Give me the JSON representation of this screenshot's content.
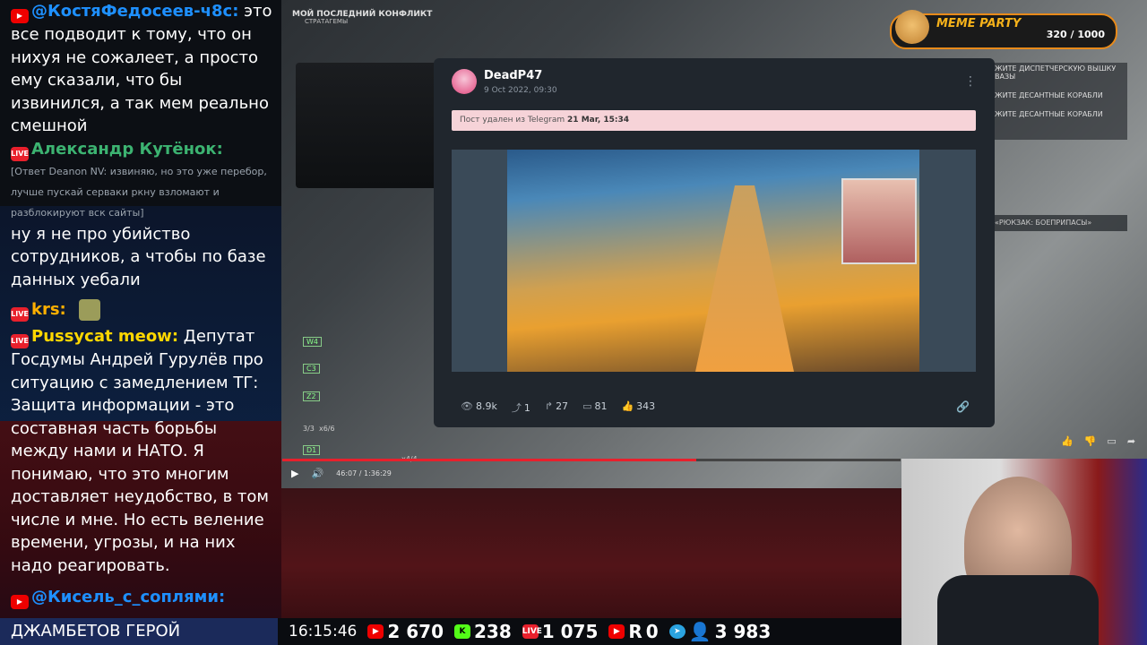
{
  "chat": {
    "messages": [
      {
        "author": "@КостяФедосеев-ч8с:",
        "text": "это все подводит к тому, что он нихуя не сожалеет, а просто ему сказали, что бы извинился, а так мем реально смешной",
        "author_color": "#1e90ff"
      },
      {
        "author": "Александр Кутёнок:",
        "reply": "[Ответ Deanon NV: извиняю, но это уже перебор, лучше пускай серваки ркну взломают и разблокируют вск сайты]",
        "text": "ну я не про убийство сотрудников, а чтобы по базе данных уебали",
        "author_color": "#3cb371"
      },
      {
        "author": "krs:",
        "text": "",
        "author_color": "#ffb000"
      },
      {
        "author": "Pussycat meow:",
        "text": "Депутат Госдумы Андрей Гурулёв про ситуацию с замедлением ТГ: Защита информации - это составная часть борьбы между нами и НАТО. Я понимаю, что это многим доставляет неудобство, в том числе и мне. Но есть веление времени, угрозы, и на них надо реагировать.",
        "author_color": "#ffd700"
      },
      {
        "author": "@Кисель_с_соплями:",
        "text": "",
        "author_color": "#1e90ff"
      }
    ]
  },
  "hud": {
    "title": "МОЙ ПОСЛЕДНИЙ КОНФЛИКТ",
    "subtitle": "СТРАТАГЕМЫ",
    "loadout": [
      {
        "code": "W4"
      },
      {
        "code": "C3"
      },
      {
        "code": "Z2"
      },
      {
        "code": "D1"
      }
    ],
    "ammo": [
      "3/3",
      "x6/6",
      "x4/4"
    ]
  },
  "card": {
    "name": "DeadP47",
    "date": "9 Oct 2022, 09:30",
    "deleted_prefix": "Пост удален из Telegram",
    "deleted_date": "21 Mar, 15:34",
    "stats": {
      "views": "8.9k",
      "shares": "1",
      "forwards": "27",
      "comments": "81",
      "likes": "343"
    }
  },
  "player": {
    "time": "46:07 / 1:36:29",
    "progress": 0.67
  },
  "meme": {
    "title": "MEME PARTY",
    "score": "320 / 1000"
  },
  "objectives": {
    "items": [
      "ЖИТЕ ДИСПЕТЧЕРСКУЮ ВЫШКУ ВАЗЫ",
      "ЖИТЕ ДЕСАНТНЫЕ КОРАБЛИ",
      "ЖИТЕ ДЕСАНТНЫЕ КОРАБЛИ"
    ],
    "pack": "«РЮКЗАК: БОЕПРИПАСЫ»"
  },
  "bottombar": {
    "chat_text": "ДЖАМБЕТОВ ГЕРОЙ",
    "clock": "16:15:46",
    "youtube": "2 670",
    "kick": "238",
    "vklive": "1 075",
    "rutube": "0",
    "telegram": "3 983"
  }
}
